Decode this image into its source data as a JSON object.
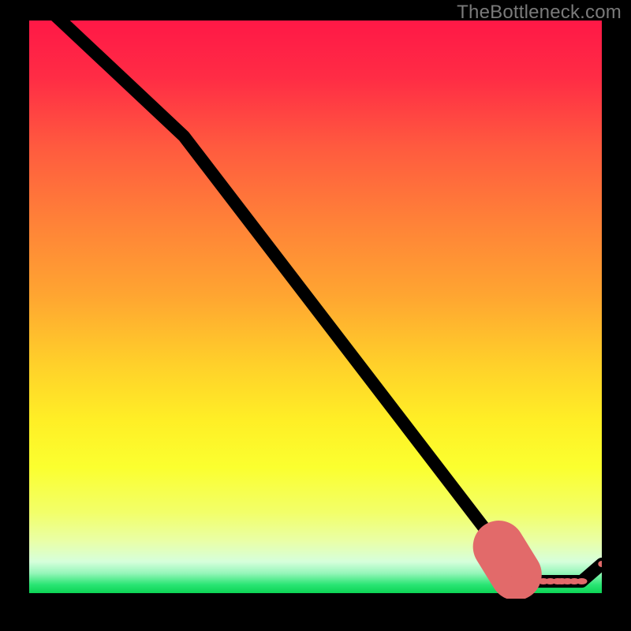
{
  "watermark": "TheBottleneck.com",
  "chart_data": {
    "type": "line",
    "title": "",
    "xlabel": "",
    "ylabel": "",
    "xlim": [
      0,
      100
    ],
    "ylim": [
      0,
      100
    ],
    "gradient_stops": [
      {
        "pos": 0.0,
        "color": "#ff1846"
      },
      {
        "pos": 0.1,
        "color": "#ff2c45"
      },
      {
        "pos": 0.22,
        "color": "#ff5a3f"
      },
      {
        "pos": 0.35,
        "color": "#ff8138"
      },
      {
        "pos": 0.48,
        "color": "#ffa531"
      },
      {
        "pos": 0.6,
        "color": "#ffd02a"
      },
      {
        "pos": 0.7,
        "color": "#ffef26"
      },
      {
        "pos": 0.78,
        "color": "#fbff2f"
      },
      {
        "pos": 0.86,
        "color": "#f2ff6a"
      },
      {
        "pos": 0.91,
        "color": "#e9ffa8"
      },
      {
        "pos": 0.945,
        "color": "#d6ffdb"
      },
      {
        "pos": 0.965,
        "color": "#96f6ba"
      },
      {
        "pos": 0.985,
        "color": "#2ae574"
      },
      {
        "pos": 1.0,
        "color": "#0cd455"
      }
    ],
    "series": [
      {
        "name": "bottleneck-curve",
        "x": [
          0.0,
          5.5,
          27.0,
          83.5,
          85.0,
          88.5,
          91.0,
          94.0,
          96.5,
          100.0
        ],
        "y": [
          105.0,
          100.0,
          80.0,
          7.0,
          4.2,
          3.0,
          3.0,
          3.0,
          3.0,
          6.0
        ]
      }
    ],
    "markers": {
      "name": "dash-points",
      "points": [
        {
          "x": 85.0,
          "y": 4.2
        },
        {
          "x": 86.8,
          "y": 3.6
        },
        {
          "x": 88.5,
          "y": 3.0
        },
        {
          "x": 89.8,
          "y": 3.0
        },
        {
          "x": 91.0,
          "y": 3.0
        },
        {
          "x": 92.3,
          "y": 3.0
        },
        {
          "x": 93.0,
          "y": 3.0
        },
        {
          "x": 94.0,
          "y": 3.0
        },
        {
          "x": 95.2,
          "y": 3.0
        },
        {
          "x": 96.5,
          "y": 3.0
        },
        {
          "x": 100.0,
          "y": 6.0
        }
      ]
    },
    "thick_segment": {
      "name": "highlight-slope",
      "start": {
        "x": 82.0,
        "y": 9.0
      },
      "end": {
        "x": 85.0,
        "y": 4.2
      }
    }
  }
}
